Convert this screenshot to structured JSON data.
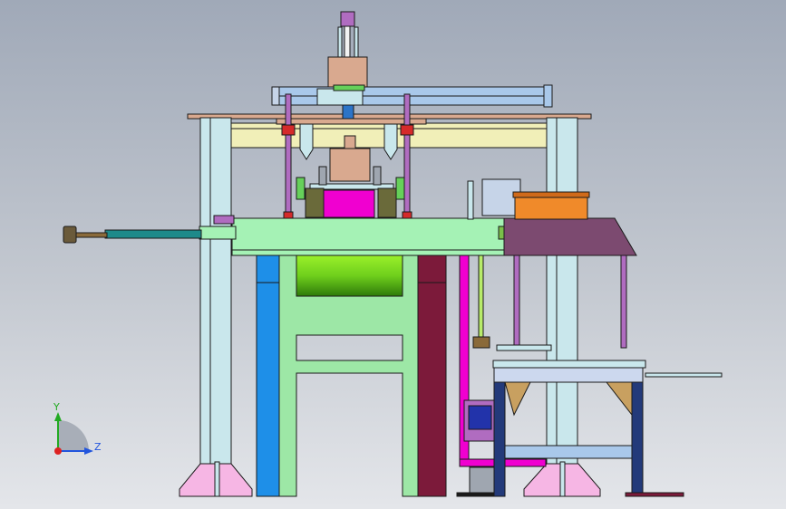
{
  "colors": {
    "outline": "#1a1a1a",
    "frame_light": "#c9e7ec",
    "plate_tan": "#d9a98f",
    "beam_cream": "#f1efb8",
    "table_green": "#a5f2b5",
    "frame_green": "#9de7a6",
    "pink_violet": "#b06cc0",
    "magenta": "#f000d0",
    "blue": "#1e8fe8",
    "maroon": "#7c1a3a",
    "navy": "#233a7a",
    "plum": "#7c4a70",
    "orange": "#f08a2a",
    "rod_teal": "#1e8a8a",
    "rail_blue": "#a9c8ea",
    "drum_green": "#6fcf1c",
    "pink_feet": "#f6b6e4"
  },
  "triad": {
    "y_label": "Y",
    "z_label": "Z",
    "y_color": "#22aa22",
    "z_color": "#2255dd",
    "x_color": "#dd2222"
  }
}
